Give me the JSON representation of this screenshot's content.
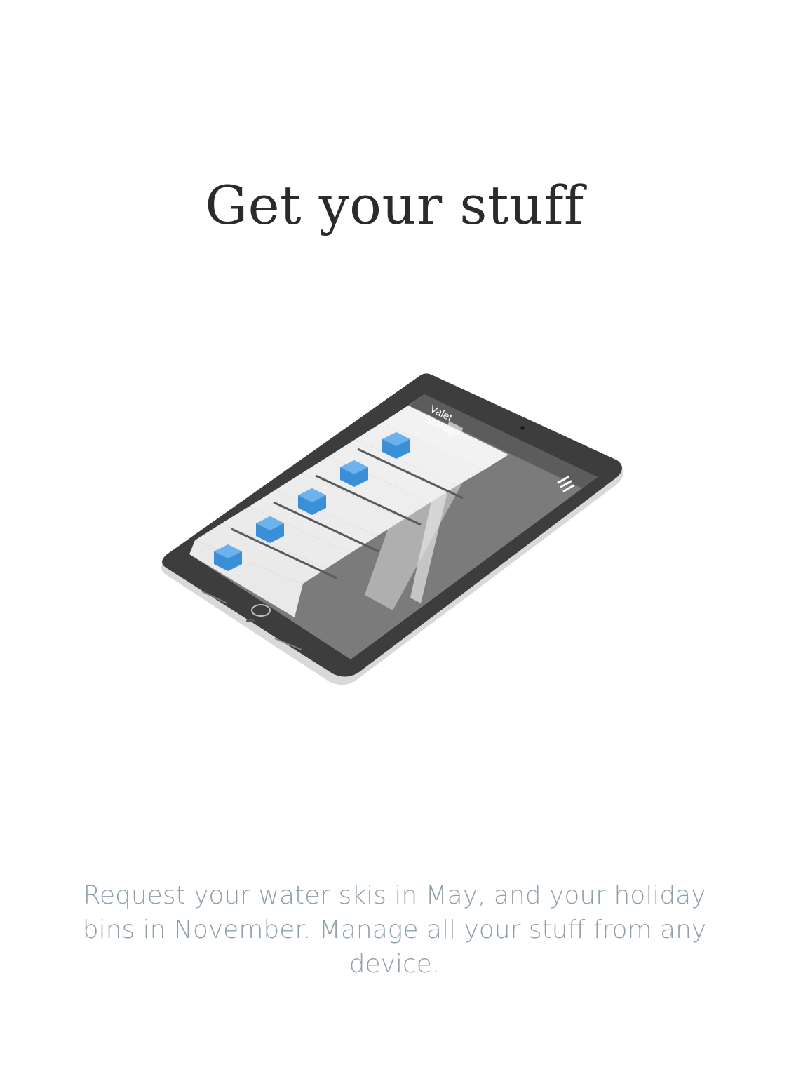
{
  "page": {
    "title": "Get your stuff",
    "description": "Request your water skis in May, and your holiday bins in November. Manage all your stuff from any device."
  },
  "illustration": {
    "device": "tablet",
    "app_brand_line1": "Valet",
    "app_brand_line2": "Storage",
    "menu_icon": "hamburger-icon",
    "item_icon": "storage-bin-icon",
    "colors": {
      "bezel": "#3f3f3f",
      "body": "#d8d8d8",
      "screen_bg": "#7a7a7a",
      "header": "#5a5a5a",
      "row": "#efefef",
      "bin": "#3a8fd6"
    }
  },
  "colors": {
    "title": "#2b2b2b",
    "description": "#8fa0ab",
    "background": "#ffffff"
  }
}
